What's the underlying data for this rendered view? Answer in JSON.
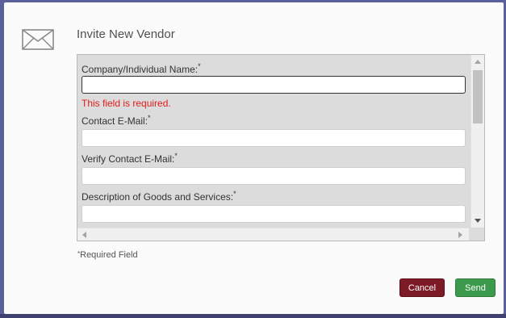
{
  "dialog": {
    "title": "Invite New Vendor",
    "icon": "envelope-icon"
  },
  "form": {
    "required_marker": "*",
    "fields": [
      {
        "label": "Company/Individual Name:",
        "value": "",
        "error": "This field is required."
      },
      {
        "label": "Contact E-Mail:",
        "value": ""
      },
      {
        "label": "Verify Contact E-Mail:",
        "value": ""
      },
      {
        "label": "Description of Goods and Services:",
        "value": ""
      }
    ],
    "required_note": "Required Field"
  },
  "buttons": {
    "cancel": "Cancel",
    "send": "Send"
  },
  "colors": {
    "error": "#e21b1b",
    "cancel": "#7c1a26",
    "send": "#3c9a4c"
  }
}
